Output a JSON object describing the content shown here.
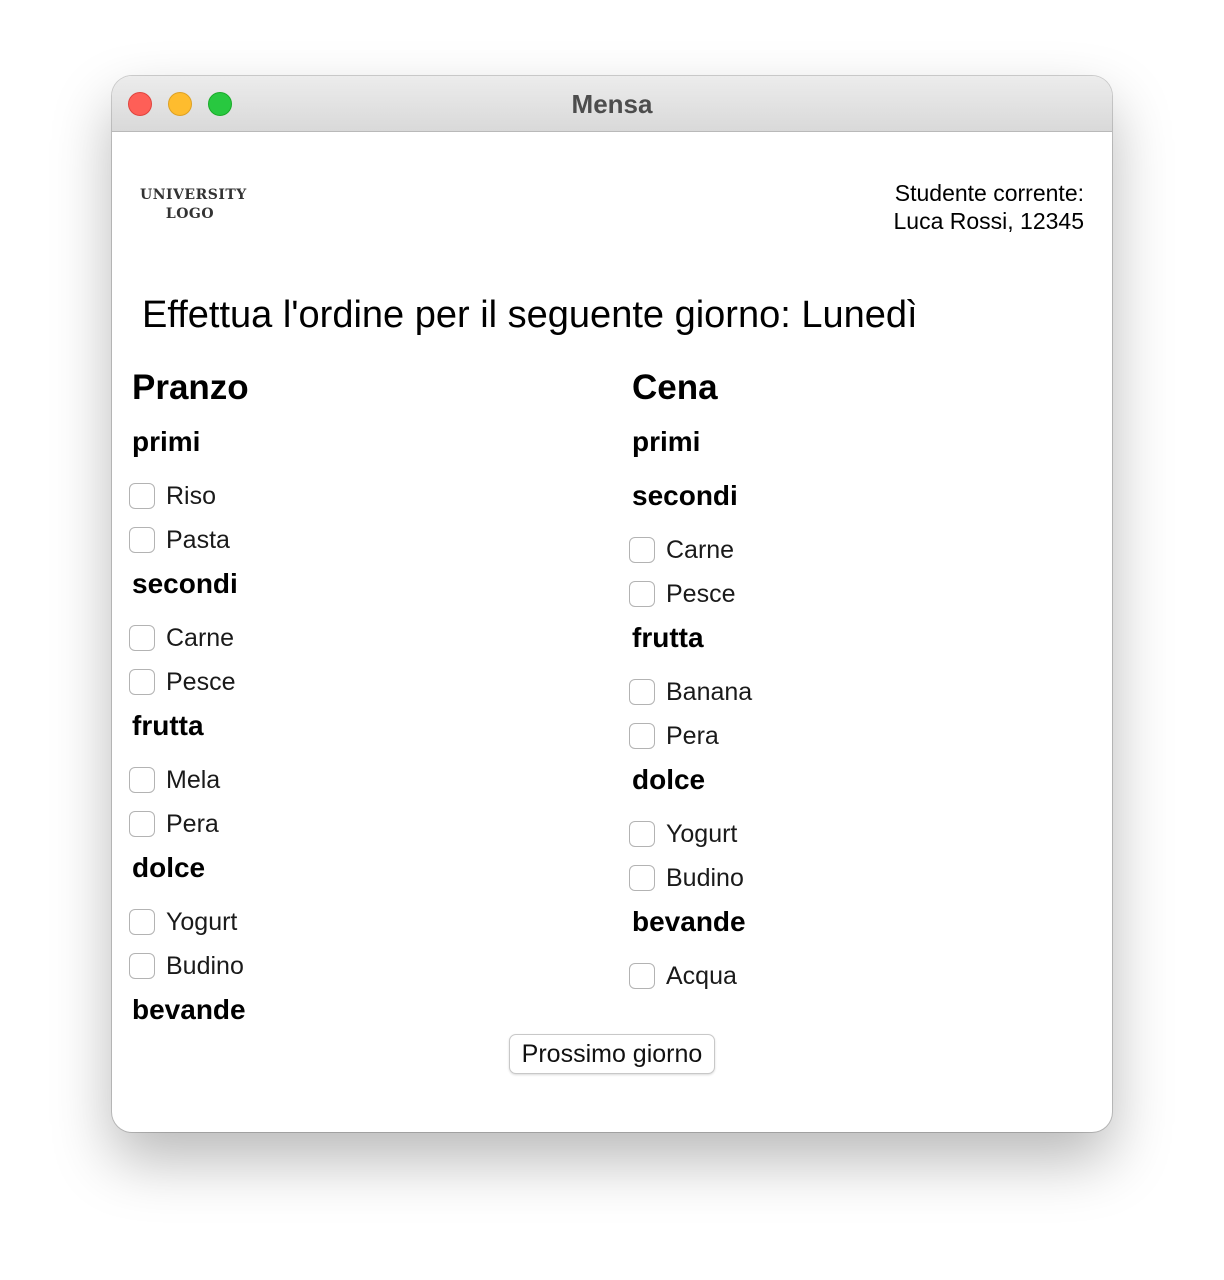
{
  "window": {
    "title": "Mensa"
  },
  "header": {
    "logo_line1": "UNIVERSITY",
    "logo_line2": "LOGO",
    "student_label": "Studente corrente:",
    "student_value": "Luca Rossi, 12345"
  },
  "main": {
    "heading": "Effettua l'ordine per il seguente giorno: Lunedì"
  },
  "pranzo": {
    "title": "Pranzo",
    "primi": {
      "label": "primi",
      "items": [
        "Riso",
        "Pasta"
      ]
    },
    "secondi": {
      "label": "secondi",
      "items": [
        "Carne",
        "Pesce"
      ]
    },
    "frutta": {
      "label": "frutta",
      "items": [
        "Mela",
        "Pera"
      ]
    },
    "dolce": {
      "label": "dolce",
      "items": [
        "Yogurt",
        "Budino"
      ]
    },
    "bevande": {
      "label": "bevande",
      "items": []
    }
  },
  "cena": {
    "title": "Cena",
    "primi": {
      "label": "primi",
      "items": []
    },
    "secondi": {
      "label": "secondi",
      "items": [
        "Carne",
        "Pesce"
      ]
    },
    "frutta": {
      "label": "frutta",
      "items": [
        "Banana",
        "Pera"
      ]
    },
    "dolce": {
      "label": "dolce",
      "items": [
        "Yogurt",
        "Budino"
      ]
    },
    "bevande": {
      "label": "bevande",
      "items": [
        "Acqua"
      ]
    }
  },
  "actions": {
    "next_day_label": "Prossimo giorno"
  }
}
